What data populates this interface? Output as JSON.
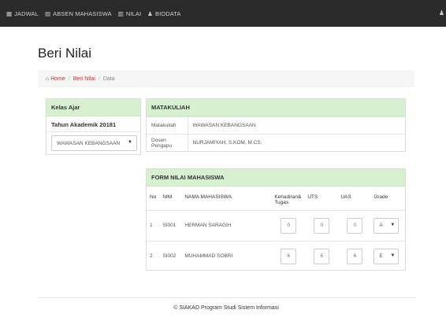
{
  "navbar": {
    "items": [
      {
        "icon": "calendar-icon",
        "label": "JADWAL"
      },
      {
        "icon": "user-icon",
        "label": "ABSEN MAHASISWA"
      },
      {
        "icon": "table-icon",
        "label": "NILAI"
      },
      {
        "icon": "person-icon",
        "label": "BIODATA"
      }
    ],
    "right_icon": "user-icon"
  },
  "page": {
    "title": "Beri Nilai"
  },
  "breadcrumb": {
    "home": "Home",
    "middle": "Beri Nilai",
    "active": "Data"
  },
  "kelas": {
    "heading": "Kelas Ajar",
    "tahun": "Tahun Akademik 20181",
    "selected": "WAWASAN KEBANGSAAN"
  },
  "matakuliah": {
    "heading": "MATAKULIAH",
    "rows": [
      {
        "label": "Matakuliah",
        "value": "WAWASAN KEBANGSAAN"
      },
      {
        "label": "Dosen Pengapu",
        "value": "NURJAMIYAH, S.KOM, M.CS."
      }
    ]
  },
  "form_nilai": {
    "heading": "FORM NILAI MAHASISWA",
    "columns": [
      "No",
      "NIM",
      "NAMA MAHASISWA",
      "Kehadiran& Tugas",
      "UTS",
      "UAS",
      "Grade"
    ],
    "rows": [
      {
        "no": "1",
        "nim": "SI001",
        "nama": "HERMAN SARAGIH",
        "kehadiran": "0",
        "uts": "0",
        "uas": "0",
        "grade": "A"
      },
      {
        "no": "2",
        "nim": "SI002",
        "nama": "MUHAMMAD SOBRI",
        "kehadiran": "6",
        "uts": "6",
        "uas": "6",
        "grade": "E"
      }
    ]
  },
  "footer": {
    "text": "© SIAKAD Program Studi Sistem Informasi"
  }
}
